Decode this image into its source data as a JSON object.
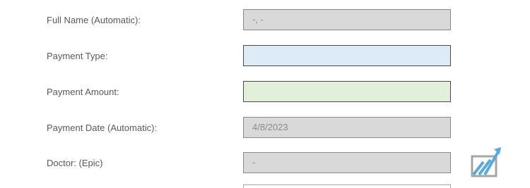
{
  "form": {
    "rows": [
      {
        "label": "Full Name  (Automatic):",
        "value": "-, -"
      },
      {
        "label": "Payment Type:",
        "value": ""
      },
      {
        "label": "Payment Amount:",
        "value": ""
      },
      {
        "label": "Payment Date  (Automatic):",
        "value": "4/8/2023"
      },
      {
        "label": "Doctor: (Epic)",
        "value": "-"
      }
    ]
  },
  "colors": {
    "readonly_fill": "#d9d9d9",
    "payment_type_fill": "#ddebf7",
    "payment_amount_fill": "#e2efda",
    "logo_accent": "#5aa9dd"
  },
  "icons": {
    "logo": "chart-growth-logo-icon"
  }
}
